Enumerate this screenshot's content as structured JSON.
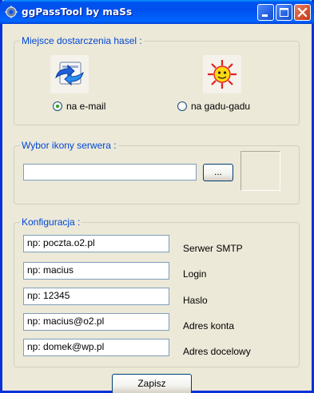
{
  "window": {
    "title": "ggPassTool by maSs"
  },
  "delivery": {
    "group_label": "Miejsce dostarczenia hasel :",
    "option_email": "na e-mail",
    "option_gg": "na gadu-gadu",
    "selected": "email"
  },
  "server_icon": {
    "group_label": "Wybor ikony serwera :",
    "path_value": "",
    "browse_label": "..."
  },
  "config": {
    "group_label": "Konfiguracja :",
    "fields": [
      {
        "value": "np: poczta.o2.pl",
        "label": "Serwer SMTP"
      },
      {
        "value": "np: macius",
        "label": "Login"
      },
      {
        "value": "np: 12345",
        "label": "Haslo"
      },
      {
        "value": "np: macius@o2.pl",
        "label": "Adres konta"
      },
      {
        "value": "np: domek@wp.pl",
        "label": "Adres docelowy"
      }
    ]
  },
  "footer": {
    "save_label": "Zapisz"
  },
  "colors": {
    "group_label": "#0046D5",
    "titlebar": "#0053EE",
    "close": "#D5512D"
  }
}
